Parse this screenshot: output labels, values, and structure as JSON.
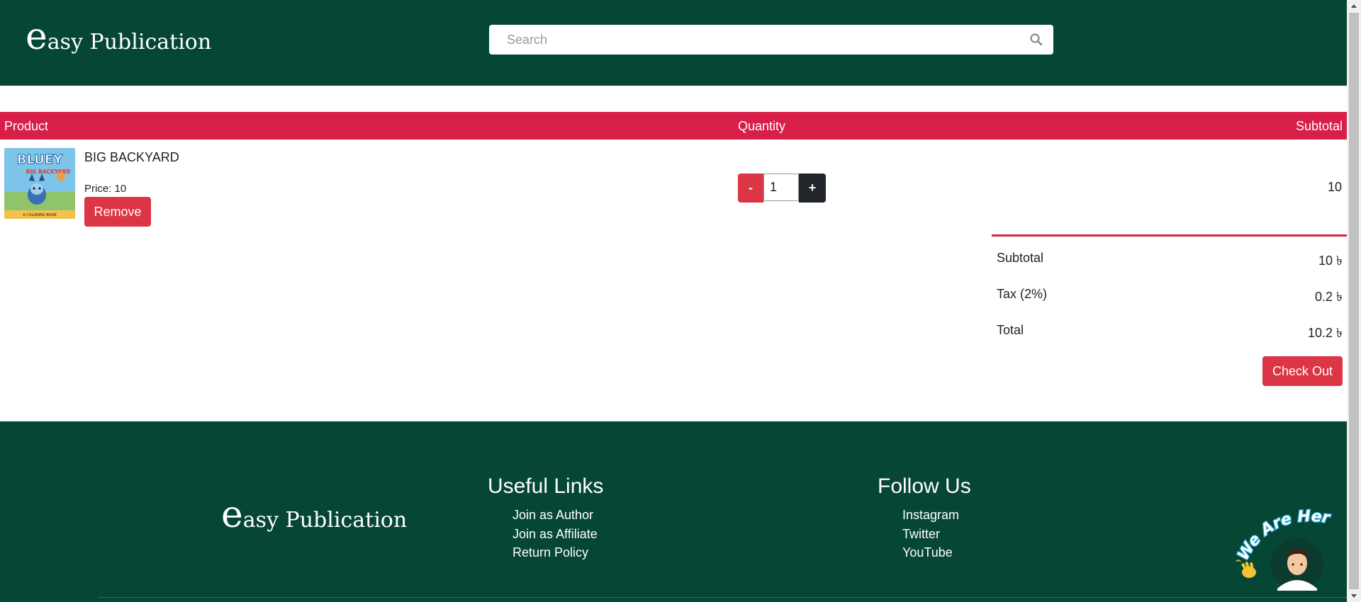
{
  "header": {
    "logo": {
      "first_letter": "e",
      "rest": "asy Publication"
    },
    "search": {
      "placeholder": "Search"
    }
  },
  "cart": {
    "columns": {
      "product": "Product",
      "quantity": "Quantity",
      "subtotal": "Subtotal"
    },
    "items": [
      {
        "name": "BIG BACKYARD",
        "price_label": "Price: 10",
        "remove_label": "Remove",
        "qty_minus": "-",
        "qty_plus": "+",
        "quantity": "1",
        "subtotal": "10",
        "cover": {
          "brand": "BLUEY",
          "subtitle": "BIG BACKYARD",
          "caption": "A COLORING BOOK"
        }
      }
    ],
    "summary": {
      "subtotal_label": "Subtotal",
      "subtotal_value": "10 ৳",
      "tax_label": "Tax (2%)",
      "tax_value": "0.2 ৳",
      "total_label": "Total",
      "total_value": "10.2 ৳"
    },
    "checkout_label": "Check Out"
  },
  "footer": {
    "logo": {
      "first_letter": "e",
      "rest": "asy Publication"
    },
    "useful_links": {
      "title": "Useful Links",
      "items": [
        "Join as Author",
        "Join as Affiliate",
        "Return Policy"
      ]
    },
    "follow_us": {
      "title": "Follow Us",
      "items": [
        "Instagram",
        "Twitter",
        "YouTube"
      ]
    },
    "chat_widget": {
      "label": "We Are Here!",
      "icon": "waving-hand-avatar"
    }
  },
  "colors": {
    "brand_green": "#064635",
    "accent_red": "#d81f47",
    "button_red": "#dc3545",
    "button_dark": "#212529"
  }
}
